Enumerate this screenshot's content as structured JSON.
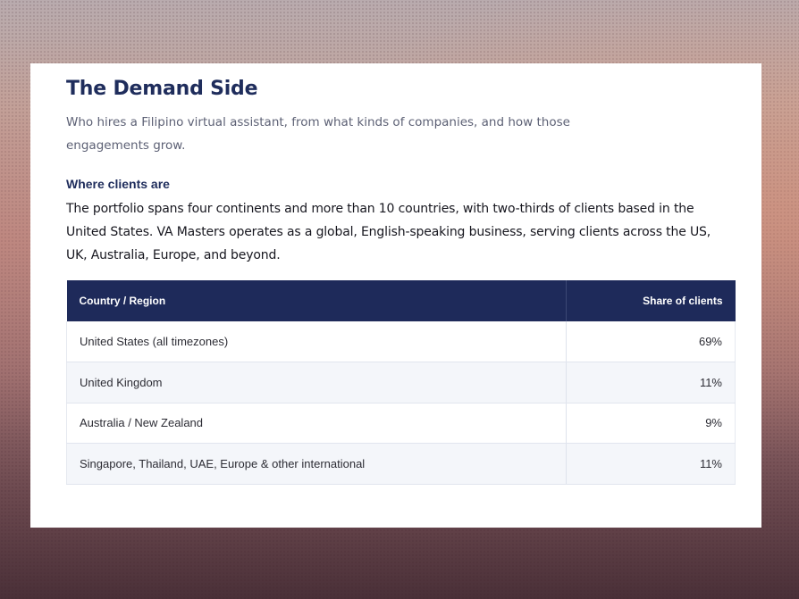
{
  "title": "The Demand Side",
  "subtitle": "Who hires a Filipino virtual assistant, from what kinds of companies, and how those engagements grow.",
  "section": {
    "heading": "Where clients are",
    "body": "The portfolio spans four continents and more than 10 countries, with two-thirds of clients based in the United States. VA Masters operates as a global, English-speaking business, serving clients across the US, UK, Australia, Europe, and beyond."
  },
  "table": {
    "headers": {
      "region": "Country / Region",
      "share": "Share of clients"
    },
    "rows": [
      {
        "region": "United States (all timezones)",
        "share": "69%"
      },
      {
        "region": "United Kingdom",
        "share": "11%"
      },
      {
        "region": "Australia / New Zealand",
        "share": "9%"
      },
      {
        "region": "Singapore, Thailand, UAE, Europe & other international",
        "share": "11%"
      }
    ]
  },
  "colors": {
    "heading_navy": "#1f2d5c",
    "table_header_bg": "#1e2a5a",
    "zebra_row_bg": "#f4f6fa"
  }
}
